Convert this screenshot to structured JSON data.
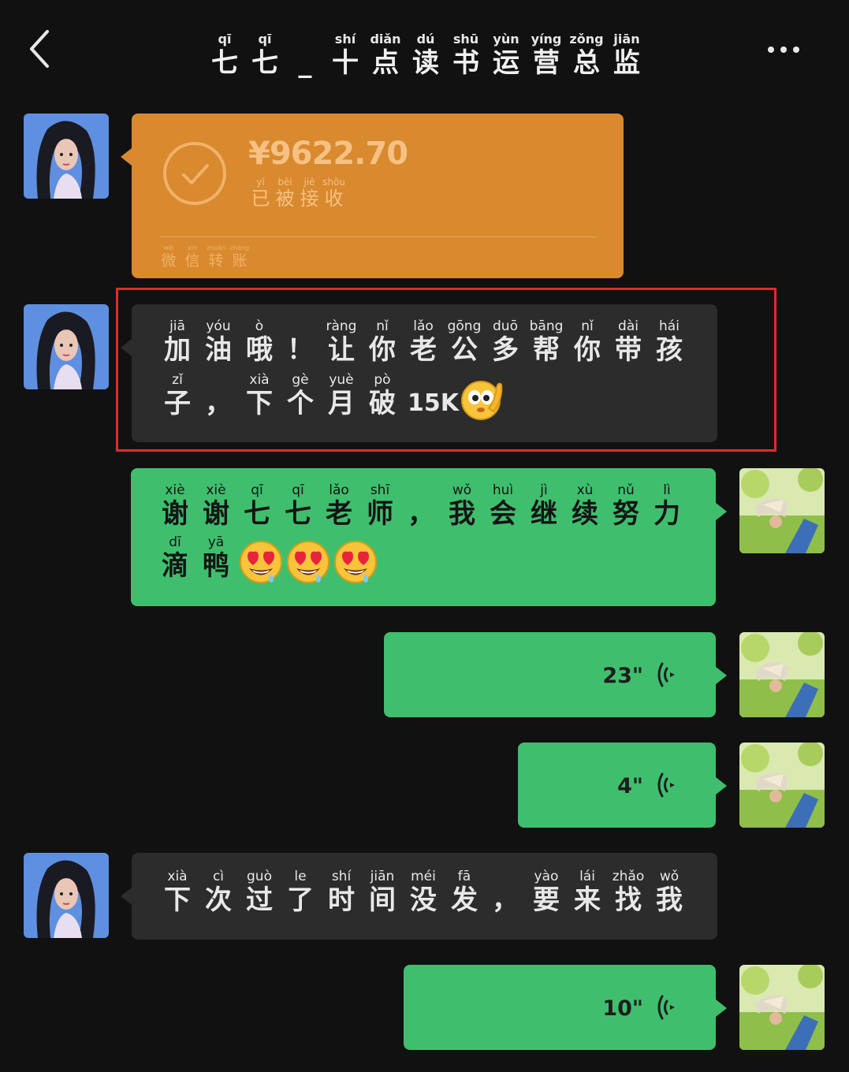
{
  "header": {
    "title_chars": [
      {
        "py": "qī",
        "hz": "七"
      },
      {
        "py": "qī",
        "hz": "七"
      },
      {
        "py": "",
        "hz": "_"
      },
      {
        "py": "shí",
        "hz": "十"
      },
      {
        "py": "diǎn",
        "hz": "点"
      },
      {
        "py": "dú",
        "hz": "读"
      },
      {
        "py": "shū",
        "hz": "书"
      },
      {
        "py": "yùn",
        "hz": "运"
      },
      {
        "py": "yíng",
        "hz": "营"
      },
      {
        "py": "zǒng",
        "hz": "总"
      },
      {
        "py": "jiān",
        "hz": "监"
      }
    ],
    "back_icon": "chevron-left-icon",
    "more_icon": "more-dots-icon"
  },
  "transfer": {
    "amount": "¥9622.70",
    "status_chars": [
      {
        "py": "yǐ",
        "hz": "已"
      },
      {
        "py": "bèi",
        "hz": "被"
      },
      {
        "py": "jiē",
        "hz": "接"
      },
      {
        "py": "shōu",
        "hz": "收"
      }
    ],
    "footer_chars": [
      {
        "py": "wēi",
        "hz": "微"
      },
      {
        "py": "xìn",
        "hz": "信"
      },
      {
        "py": "zhuǎn",
        "hz": "转"
      },
      {
        "py": "zhàng",
        "hz": "账"
      }
    ]
  },
  "messages": {
    "m2_line1": [
      {
        "py": "jiā",
        "hz": "加"
      },
      {
        "py": "yóu",
        "hz": "油"
      },
      {
        "py": "ò",
        "hz": "哦"
      },
      {
        "py": "",
        "hz": "！"
      },
      {
        "py": "ràng",
        "hz": "让"
      },
      {
        "py": "nǐ",
        "hz": "你"
      },
      {
        "py": "lǎo",
        "hz": "老"
      },
      {
        "py": "gōng",
        "hz": "公"
      },
      {
        "py": "duō",
        "hz": "多"
      },
      {
        "py": "bāng",
        "hz": "帮"
      },
      {
        "py": "nǐ",
        "hz": "你"
      },
      {
        "py": "dài",
        "hz": "带"
      },
      {
        "py": "hái",
        "hz": "孩"
      }
    ],
    "m2_line2": [
      {
        "py": "zǐ",
        "hz": "子"
      },
      {
        "py": "",
        "hz": "，"
      },
      {
        "py": "xià",
        "hz": "下"
      },
      {
        "py": "gè",
        "hz": "个"
      },
      {
        "py": "yuè",
        "hz": "月"
      },
      {
        "py": "pò",
        "hz": "破"
      }
    ],
    "m2_suffix": "15K",
    "m3_line1": [
      {
        "py": "xiè",
        "hz": "谢"
      },
      {
        "py": "xiè",
        "hz": "谢"
      },
      {
        "py": "qī",
        "hz": "七"
      },
      {
        "py": "qī",
        "hz": "七"
      },
      {
        "py": "lǎo",
        "hz": "老"
      },
      {
        "py": "shī",
        "hz": "师"
      },
      {
        "py": "",
        "hz": "，"
      },
      {
        "py": "wǒ",
        "hz": "我"
      },
      {
        "py": "huì",
        "hz": "会"
      },
      {
        "py": "jì",
        "hz": "继"
      },
      {
        "py": "xù",
        "hz": "续"
      },
      {
        "py": "nǔ",
        "hz": "努"
      },
      {
        "py": "lì",
        "hz": "力"
      }
    ],
    "m3_line2": [
      {
        "py": "dī",
        "hz": "滴"
      },
      {
        "py": "yā",
        "hz": "鸭"
      }
    ],
    "voice1": "23\"",
    "voice2": "4\"",
    "m6_line1": [
      {
        "py": "xià",
        "hz": "下"
      },
      {
        "py": "cì",
        "hz": "次"
      },
      {
        "py": "guò",
        "hz": "过"
      },
      {
        "py": "le",
        "hz": "了"
      },
      {
        "py": "shí",
        "hz": "时"
      },
      {
        "py": "jiān",
        "hz": "间"
      },
      {
        "py": "méi",
        "hz": "没"
      },
      {
        "py": "fā",
        "hz": "发"
      },
      {
        "py": "",
        "hz": "，"
      },
      {
        "py": "yào",
        "hz": "要"
      },
      {
        "py": "lái",
        "hz": "来"
      },
      {
        "py": "zhǎo",
        "hz": "找"
      },
      {
        "py": "wǒ",
        "hz": "我"
      }
    ],
    "voice3": "10\""
  },
  "icons": {
    "check": "check-circle-icon",
    "voice": "voice-wave-icon",
    "emoji_flushed": "eyes-face-emoji-icon",
    "emoji_heart_eyes": "heart-eyes-emoji-icon"
  },
  "colors": {
    "background": "#111111",
    "incoming_bubble": "#2c2c2c",
    "outgoing_bubble": "#3fbf6e",
    "transfer_card": "#d9892e",
    "highlight_border": "#e02b2b"
  }
}
